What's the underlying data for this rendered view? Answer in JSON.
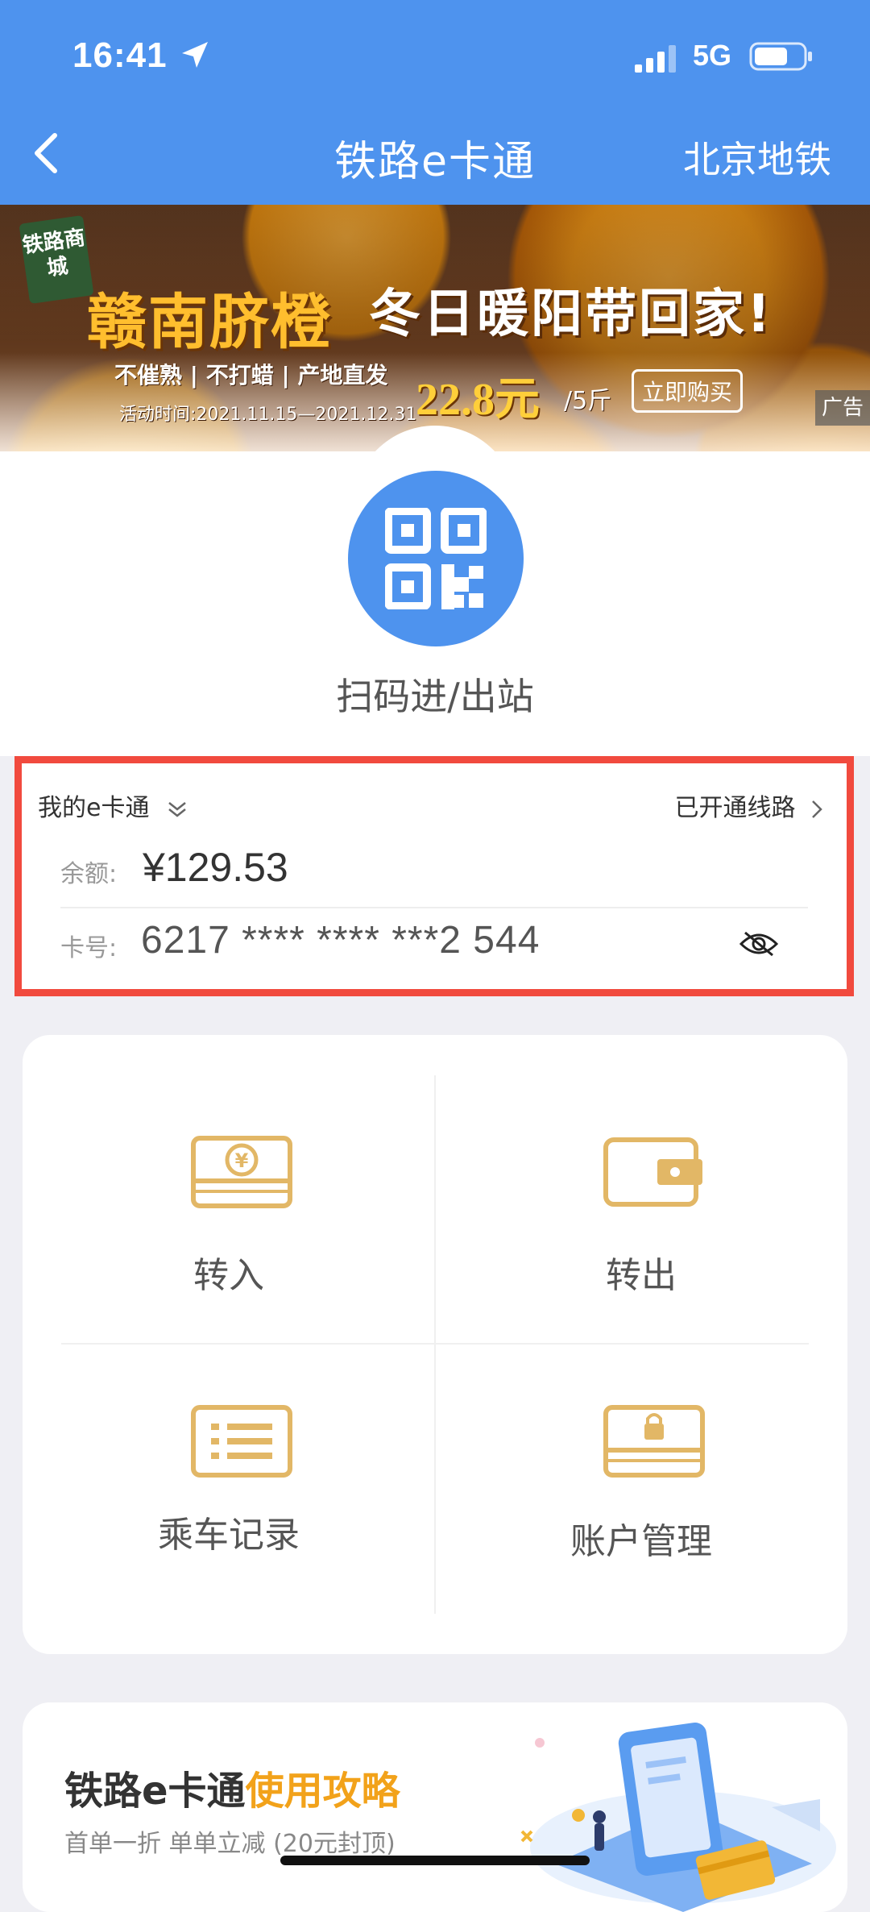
{
  "status_bar": {
    "time": "16:41",
    "network": "5G",
    "icons": [
      "location-arrow-icon",
      "signal-icon",
      "battery-icon"
    ]
  },
  "nav": {
    "title": "铁路e卡通",
    "right_label": "北京地铁",
    "back_icon": "chevron-left-icon"
  },
  "banner": {
    "badge": "铁路商城",
    "headline": "赣南脐橙",
    "headline2": "冬日暖阳带回家!",
    "features": "不催熟 | 不打蜡 | 产地直发",
    "date": "活动时间:2021.11.15—2021.12.31",
    "price": "22.8元",
    "unit": "/5斤",
    "buy_button": "立即购买",
    "ad_tag": "广告"
  },
  "scan": {
    "label": "扫码进/出站",
    "icon": "qr-code-icon"
  },
  "card_info": {
    "title": "我的e卡通",
    "lines_link": "已开通线路",
    "balance_label": "余额:",
    "balance": "¥129.53",
    "card_label": "卡号:",
    "card_number": "6217 **** **** ***2 544"
  },
  "functions": {
    "items": [
      {
        "label": "转入",
        "icon": "transfer-in-icon"
      },
      {
        "label": "转出",
        "icon": "wallet-icon"
      },
      {
        "label": "乘车记录",
        "icon": "ride-records-icon"
      },
      {
        "label": "账户管理",
        "icon": "account-lock-icon"
      }
    ]
  },
  "guide": {
    "title_prefix": "铁路e卡通",
    "title_highlight": "使用攻略",
    "subtitle": "首单一折 单单立减 (20元封顶)"
  },
  "colors": {
    "primary_blue": "#4e93ee",
    "gold": "#e2b766",
    "highlight_orange": "#f2a21a",
    "red_box": "#f14a3e"
  }
}
